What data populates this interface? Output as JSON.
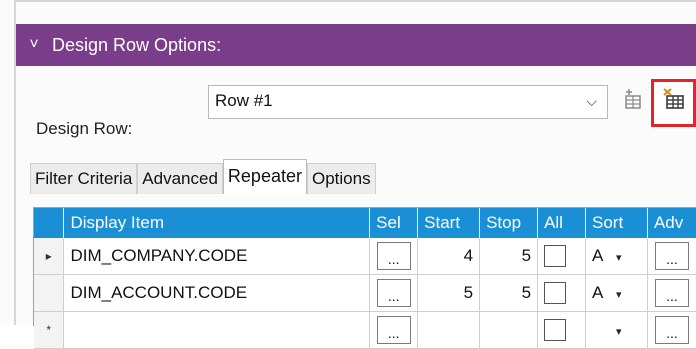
{
  "panel": {
    "title": "Design Row Options:",
    "collapse_glyph": "˅"
  },
  "design_row": {
    "label": "Design Row:",
    "value": "Row #1",
    "dropdown_glyph": "⌵"
  },
  "toolbar": {
    "icons": [
      "insert-row-icon",
      "delete-row-icon"
    ],
    "highlight_color": "#e3252b"
  },
  "tabs": [
    {
      "label": "Filter Criteria",
      "active": false
    },
    {
      "label": "Advanced",
      "active": false
    },
    {
      "label": "Repeater",
      "active": true
    },
    {
      "label": "Options",
      "active": false
    }
  ],
  "grid": {
    "columns": [
      "Display Item",
      "Sel",
      "Start",
      "Stop",
      "All",
      "Sort",
      "Adv"
    ],
    "rows": [
      {
        "marker": "▸",
        "display_item": "DIM_COMPANY.CODE",
        "sel": "...",
        "start": "4",
        "stop": "5",
        "sort": "A",
        "adv": "..."
      },
      {
        "marker": "",
        "display_item": "DIM_ACCOUNT.CODE",
        "sel": "...",
        "start": "5",
        "stop": "5",
        "sort": "A",
        "adv": "..."
      },
      {
        "marker": "*",
        "display_item": "",
        "sel": "...",
        "start": "",
        "stop": "",
        "sort": "",
        "adv": "..."
      }
    ],
    "header_color": "#1a8fd6"
  },
  "colors": {
    "header_bg": "#7a3d8a"
  }
}
